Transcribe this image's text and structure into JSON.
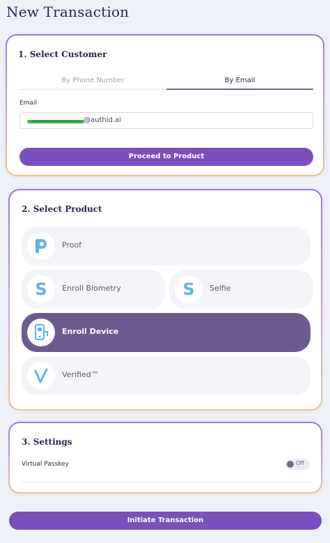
{
  "page": {
    "title": "New Transaction"
  },
  "customer": {
    "title": "1. Select Customer",
    "tabs": [
      {
        "label": "By Phone Number",
        "active": false
      },
      {
        "label": "By Email",
        "active": true
      }
    ],
    "email_label": "Email",
    "email_value_visible": "@authid.ai",
    "proceed_label": "Proceed to Product"
  },
  "product": {
    "title": "2. Select Product",
    "items": [
      {
        "label": "Proof",
        "icon": "p-logo-icon",
        "selected": false
      },
      {
        "label": "Enroll Biometry",
        "icon": "s-logo-icon",
        "selected": false
      },
      {
        "label": "Selfie",
        "icon": "s-logo-icon",
        "selected": false
      },
      {
        "label": "Enroll Device",
        "icon": "phone-device-icon",
        "selected": true
      },
      {
        "label": "Verified™",
        "icon": "checkmark-v-icon",
        "selected": false
      }
    ]
  },
  "settings": {
    "title": "3. Settings",
    "virtual_passkey_label": "Virtual Passkey",
    "virtual_passkey_state": "Off"
  },
  "actions": {
    "initiate_label": "Initiate Transaction"
  },
  "colors": {
    "primary": "#7b4fbd",
    "selected_tile": "#6b5b8e",
    "icon_blue": "#5fb3e3",
    "background": "#eef0f8"
  }
}
